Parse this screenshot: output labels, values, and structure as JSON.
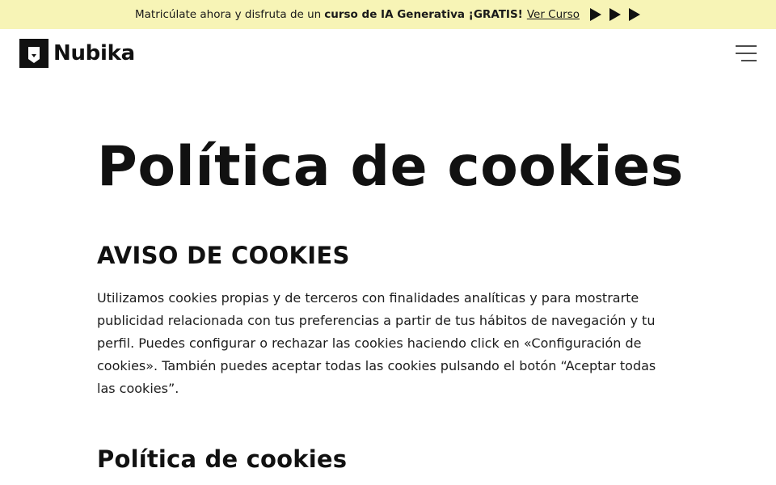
{
  "promo": {
    "text_before": "Matricúlate ahora y disfruta de un",
    "text_bold": "curso de IA Generativa ¡GRATIS!",
    "link_label": "Ver Curso"
  },
  "header": {
    "brand_name": "Nubika"
  },
  "main": {
    "page_title": "Política de cookies",
    "section_title": "AVISO DE COOKIES",
    "notice_text": "Utilizamos cookies propias y de terceros con finalidades analíticas y para mostrarte publicidad relacionada con tus preferencias a partir de tus hábitos de navegación y tu perfil. Puedes configurar o rechazar las cookies haciendo click en «Configuración de cookies». También puedes aceptar todas las cookies pulsando el botón “Aceptar todas las cookies”.",
    "subsection_title": "Política de cookies"
  },
  "colors": {
    "promo_background": "#f7f4b6",
    "text": "#111111",
    "background": "#ffffff"
  },
  "icons": {
    "promo_arrows": "play-icon",
    "menu": "hamburger-menu-icon",
    "logo": "nubika-logo-mark"
  }
}
